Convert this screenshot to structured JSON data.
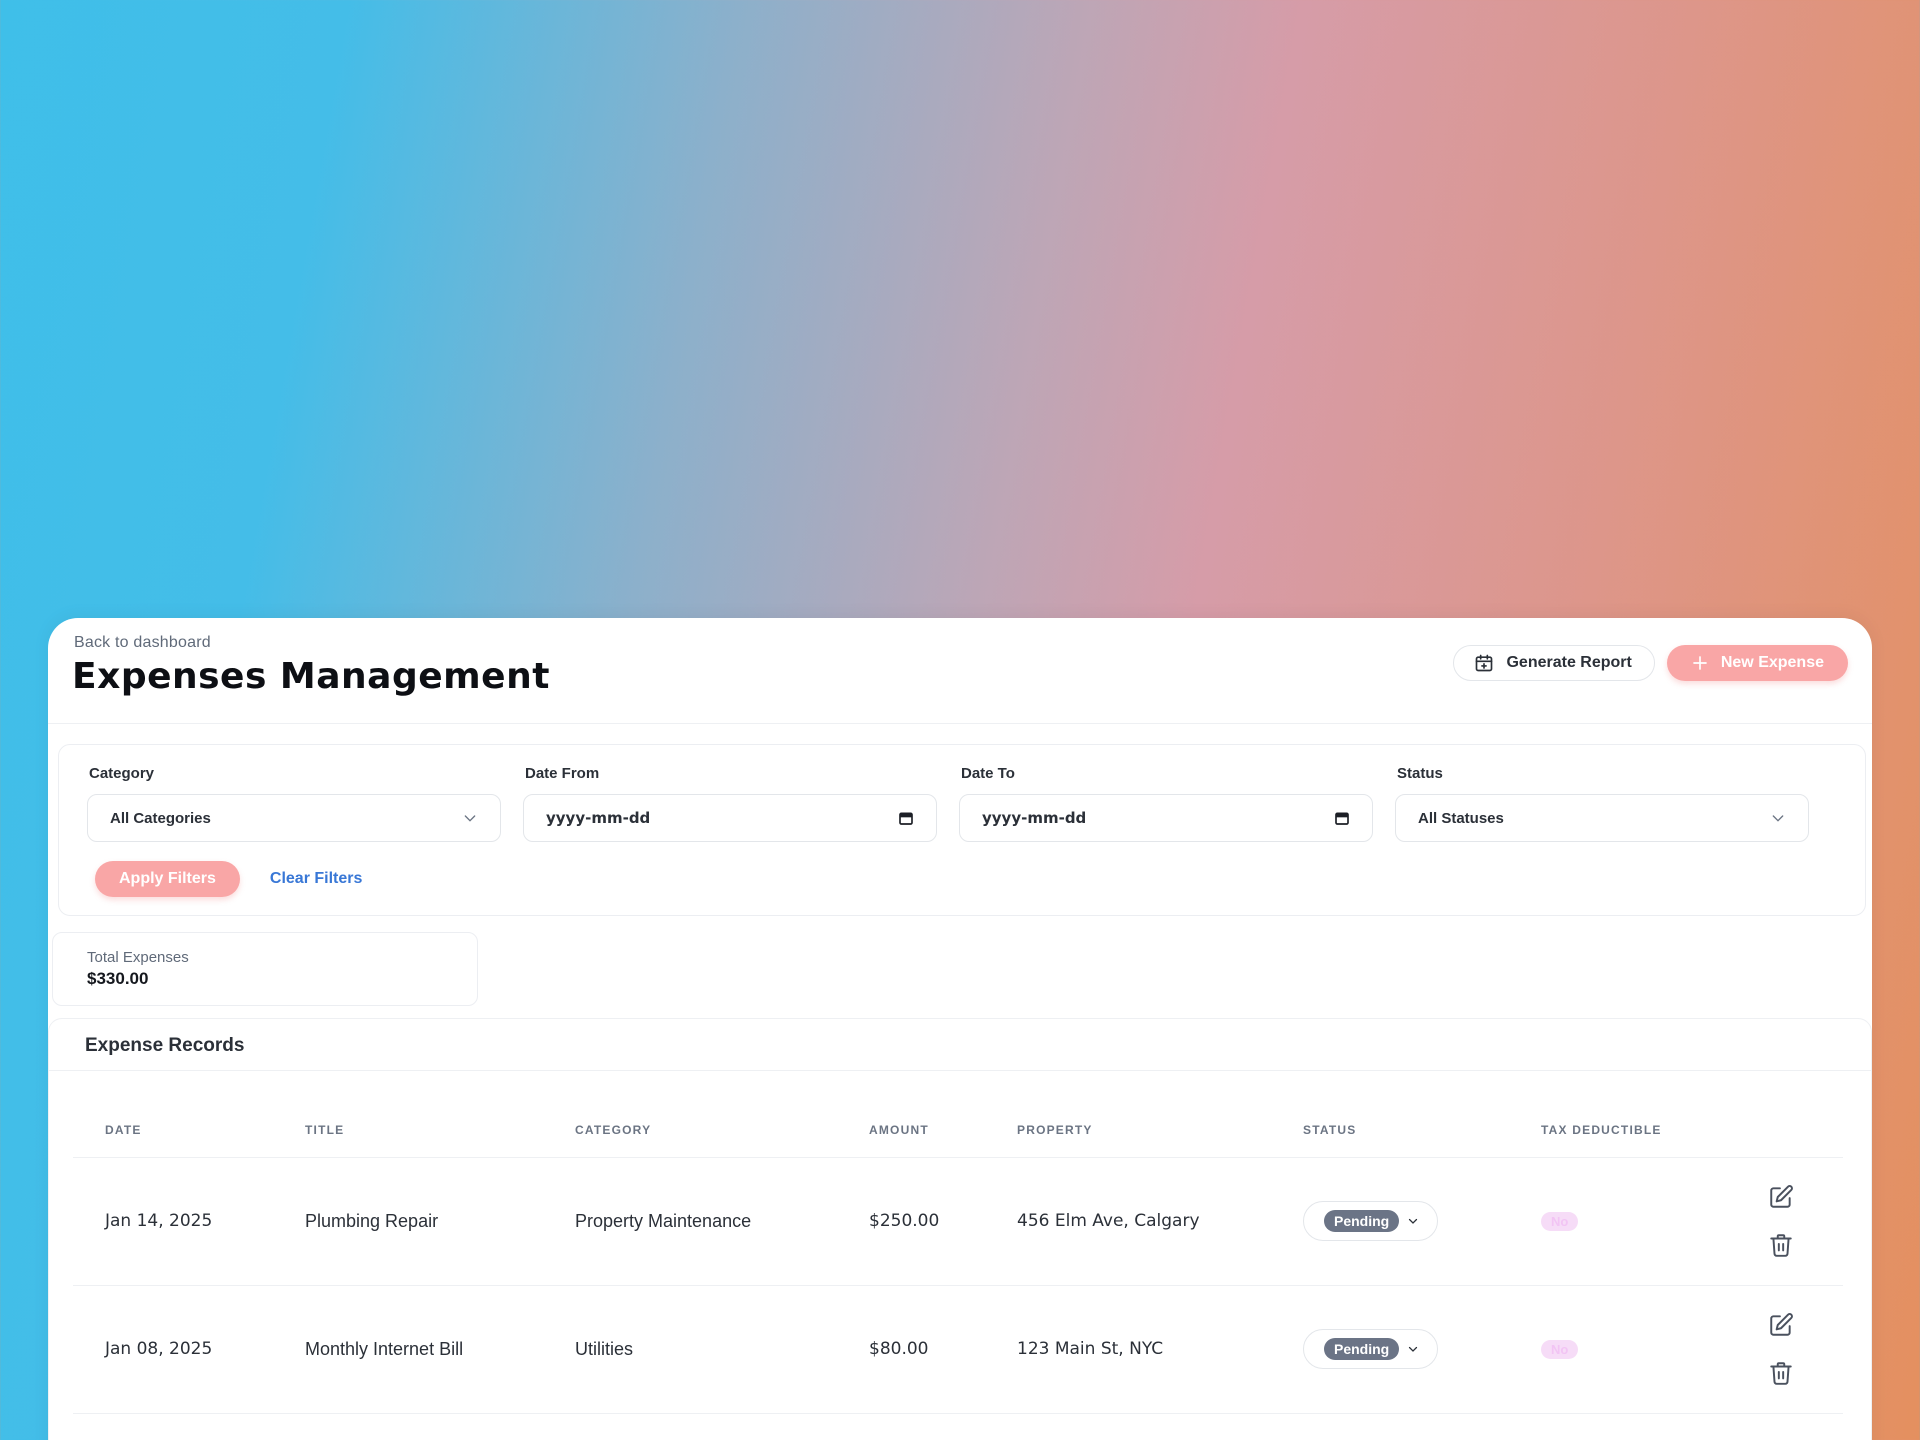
{
  "header": {
    "back_link": "Back to dashboard",
    "title": "Expenses Management",
    "generate_report_label": "Generate Report",
    "new_expense_label": "New Expense"
  },
  "filters": {
    "category_label": "Category",
    "category_value": "All Categories",
    "date_from_label": "Date From",
    "date_from_placeholder": "yyyy-mm-dd",
    "date_to_label": "Date To",
    "date_to_placeholder": "yyyy-mm-dd",
    "status_label": "Status",
    "status_value": "All Statuses",
    "apply_label": "Apply Filters",
    "clear_label": "Clear Filters"
  },
  "summary": {
    "label": "Total Expenses",
    "value": "$330.00"
  },
  "records": {
    "title": "Expense Records",
    "columns": [
      "DATE",
      "TITLE",
      "CATEGORY",
      "AMOUNT",
      "PROPERTY",
      "STATUS",
      "TAX DEDUCTIBLE"
    ],
    "rows": [
      {
        "date": "Jan 14, 2025",
        "title": "Plumbing Repair",
        "category": "Property Maintenance",
        "amount": "$250.00",
        "property": "456 Elm Ave, Calgary",
        "status": "Pending",
        "tax_deductible": "No"
      },
      {
        "date": "Jan 08, 2025",
        "title": "Monthly Internet Bill",
        "category": "Utilities",
        "amount": "$80.00",
        "property": "123 Main St, NYC",
        "status": "Pending",
        "tax_deductible": "No"
      }
    ]
  },
  "colors": {
    "primary": "#f9a6a6",
    "link": "#3877d6",
    "status_badge": "#6b7486",
    "tax_badge_bg": "#f6dcf7"
  },
  "icons": [
    "calendar-plus-icon",
    "plus-icon",
    "chevron-down-icon",
    "calendar-icon",
    "edit-icon",
    "trash-icon"
  ]
}
